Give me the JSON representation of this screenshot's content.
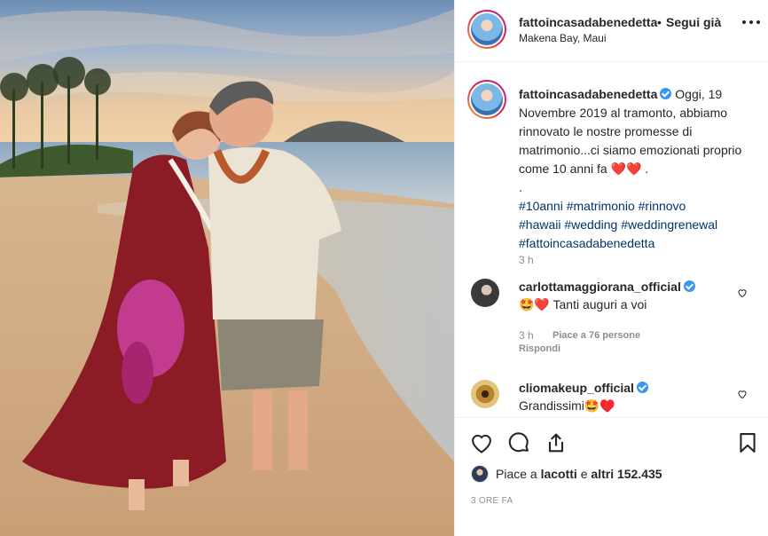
{
  "post": {
    "username": "fattoincasadabenedetta",
    "separator": "•",
    "follow_state": "Segui già",
    "location": "Makena Bay, Maui",
    "more_icon": "more-options-icon"
  },
  "caption": {
    "username": "fattoincasadabenedetta",
    "text": "Oggi, 19 Novembre 2019 al tramonto, abbiamo rinnovato le nostre promesse di matrimonio...ci siamo emozionati proprio come 10 anni fa",
    "hearts": "❤️❤️",
    "end": ".",
    "dot_line": ".",
    "hashtags_line1": "#10anni #matrimonio #rinnovo",
    "hashtags_line2": "#hawaii #wedding #weddingrenewal",
    "hashtags_line3": "#fattoincasadabenedetta",
    "time": "3 h"
  },
  "comments": [
    {
      "username": "carlottamaggiorana_official",
      "verified": true,
      "text": "🤩❤️ Tanti auguri a voi",
      "time": "3 h",
      "likes": "Piace a 76 persone",
      "reply": "Rispondi"
    },
    {
      "username": "cliomakeup_official",
      "verified": true,
      "text": "Grandissimi🤩♥️"
    }
  ],
  "actions": {
    "like_icon": "heart-icon",
    "comment_icon": "comment-icon",
    "share_icon": "share-icon",
    "save_icon": "bookmark-icon"
  },
  "likes": {
    "prefix": "Piace a",
    "user": "lacotti",
    "middle": "e",
    "others": "altri 152.435"
  },
  "date": "3 ORE FA",
  "colors": {
    "link": "#003569",
    "verified": "#3897f0",
    "heart": "#ed1c24",
    "secondary_text": "#8e8e8e",
    "border": "#efefef"
  }
}
